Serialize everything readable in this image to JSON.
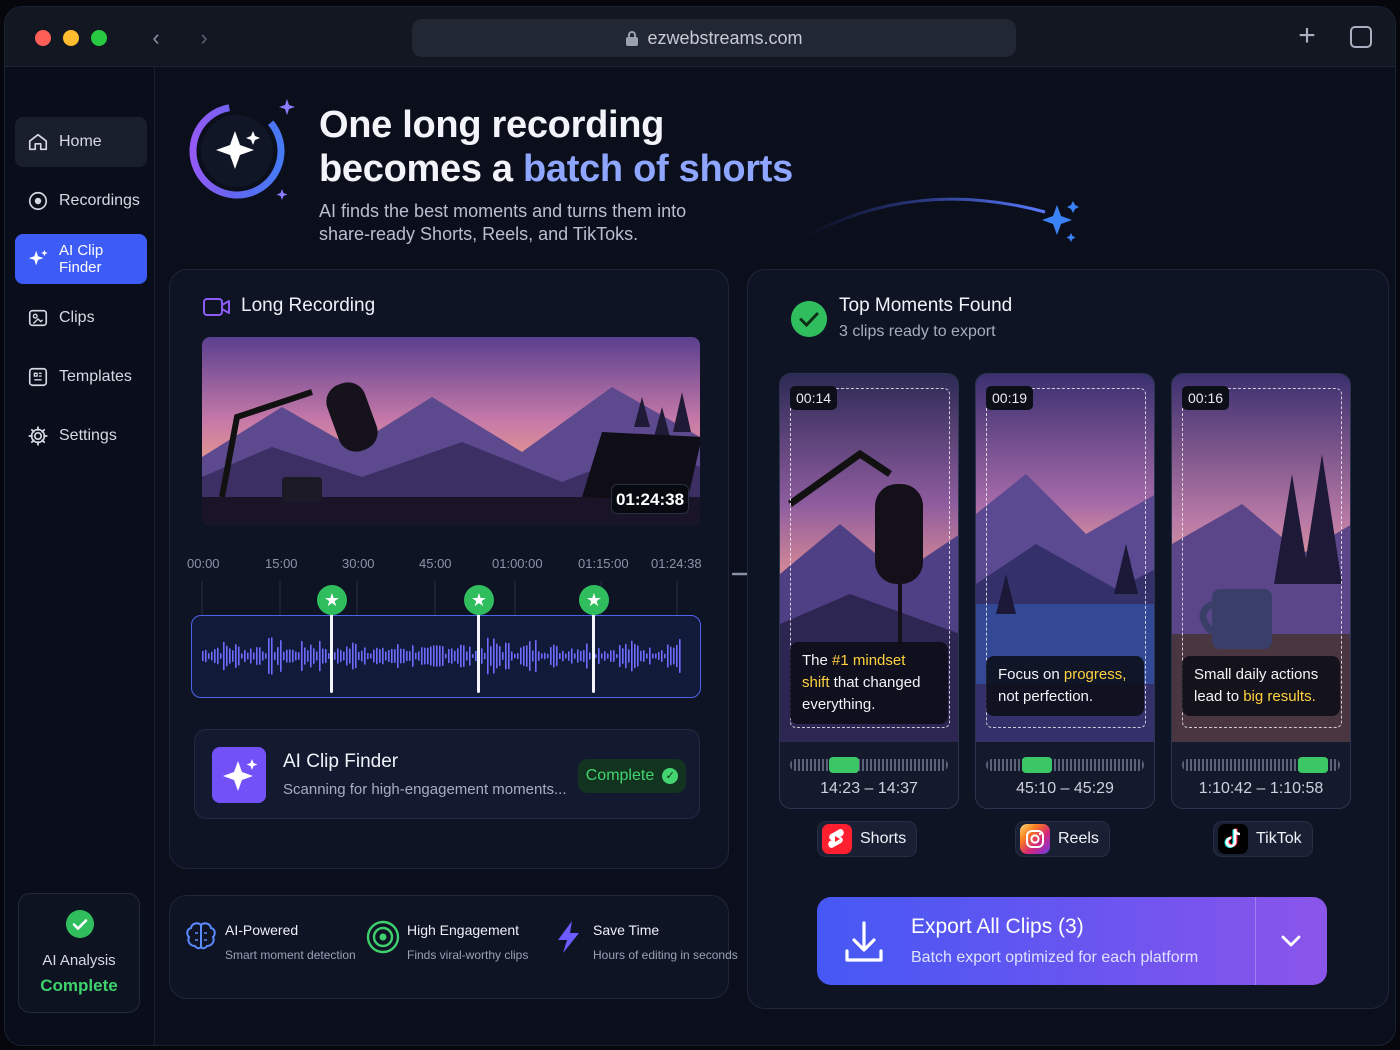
{
  "browser": {
    "url": "ezwebstreams.com"
  },
  "sidebar": {
    "items": [
      {
        "label": "Home",
        "icon": "home-icon"
      },
      {
        "label": "Recordings",
        "icon": "record-icon"
      },
      {
        "label": "AI Clip Finder",
        "icon": "sparkle-icon"
      },
      {
        "label": "Clips",
        "icon": "clips-icon"
      },
      {
        "label": "Templates",
        "icon": "templates-icon"
      },
      {
        "label": "Settings",
        "icon": "gear-icon"
      }
    ],
    "active": "AI Clip Finder",
    "status_line1": "AI Analysis",
    "status_line2": "Complete"
  },
  "hero": {
    "title_line1": "One long recording",
    "title_line2_prefix": "becomes a ",
    "title_line2_accent": "batch of shorts",
    "subtitle_line1": "AI finds the best moments and turns them into",
    "subtitle_line2": "share-ready Shorts, Reels, and TikToks."
  },
  "recording": {
    "title": "Long Recording",
    "duration": "01:24:38",
    "ticks": [
      "00:00",
      "15:00",
      "30:00",
      "45:00",
      "01:00:00",
      "01:15:00",
      "01:24:38"
    ]
  },
  "finder": {
    "title": "AI Clip Finder",
    "subtitle": "Scanning for high-engagement moments...",
    "status": "Complete"
  },
  "features": [
    {
      "title": "AI-Powered",
      "subtitle": "Smart moment detection",
      "icon": "brain-icon"
    },
    {
      "title": "High Engagement",
      "subtitle": "Finds viral-worthy clips",
      "icon": "target-icon"
    },
    {
      "title": "Save Time",
      "subtitle": "Hours of editing in seconds",
      "icon": "lightning-icon"
    }
  ],
  "moments": {
    "title": "Top Moments Found",
    "subtitle": "3 clips ready to export",
    "clips": [
      {
        "length": "00:14",
        "caption_a": "The ",
        "caption_hl": "#1 mindset shift",
        "caption_b": " that changed everything.",
        "range": "14:23 – 14:37",
        "platform": "Shorts",
        "platform_icon": "youtube-shorts-icon",
        "selection": 0.34
      },
      {
        "length": "00:19",
        "caption_a": "Focus on ",
        "caption_hl": "progress,",
        "caption_b": " not perfection.",
        "range": "45:10 – 45:29",
        "platform": "Reels",
        "platform_icon": "instagram-icon",
        "selection": 0.32
      },
      {
        "length": "00:16",
        "caption_a": "Small daily actions lead to ",
        "caption_hl": "big results.",
        "caption_b": "",
        "range": "1:10:42 – 1:10:58",
        "platform": "TikTok",
        "platform_icon": "tiktok-icon",
        "selection": 0.83
      }
    ]
  },
  "export": {
    "title": "Export All Clips (3)",
    "subtitle": "Batch export optimized for each platform"
  },
  "colors": {
    "accent": "#3d5bf5",
    "success": "#2fbd5d",
    "highlight": "#ffd23f",
    "hero_accent": "#8ea6ff"
  }
}
